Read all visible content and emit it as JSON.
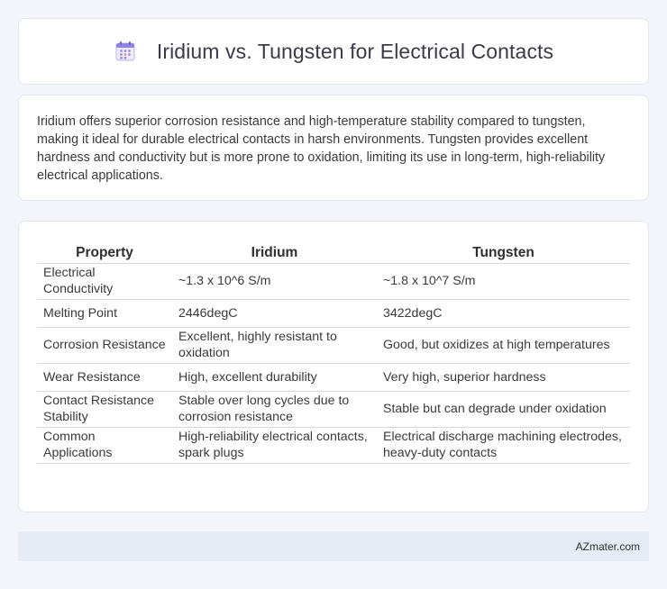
{
  "header": {
    "title": "Iridium vs. Tungsten for Electrical Contacts",
    "icon": "calendar-icon"
  },
  "summary": {
    "text": "Iridium offers superior corrosion resistance and high-temperature stability compared to tungsten, making it ideal for durable electrical contacts in harsh environments. Tungsten provides excellent hardness and conductivity but is more prone to oxidation, limiting its use in long-term, high-reliability electrical applications."
  },
  "table": {
    "headers": [
      "Property",
      "Iridium",
      "Tungsten"
    ],
    "rows": [
      [
        "Electrical Conductivity",
        "~1.3 x 10^6 S/m",
        "~1.8 x 10^7 S/m"
      ],
      [
        "Melting Point",
        "2446degC",
        "3422degC"
      ],
      [
        "Corrosion Resistance",
        "Excellent, highly resistant to oxidation",
        "Good, but oxidizes at high temperatures"
      ],
      [
        "Wear Resistance",
        "High, excellent durability",
        "Very high, superior hardness"
      ],
      [
        "Contact Resistance Stability",
        "Stable over long cycles due to corrosion resistance",
        "Stable but can degrade under oxidation"
      ],
      [
        "Common Applications",
        "High-reliability electrical contacts, spark plugs",
        "Electrical discharge machining electrodes, heavy-duty contacts"
      ]
    ]
  },
  "footer": {
    "text": "AZmater.com"
  },
  "colors": {
    "background": "#f3f5fa",
    "card": "#ffffff",
    "footer_bg": "#e6ebf6",
    "icon_accent": "#7b6fd6"
  }
}
